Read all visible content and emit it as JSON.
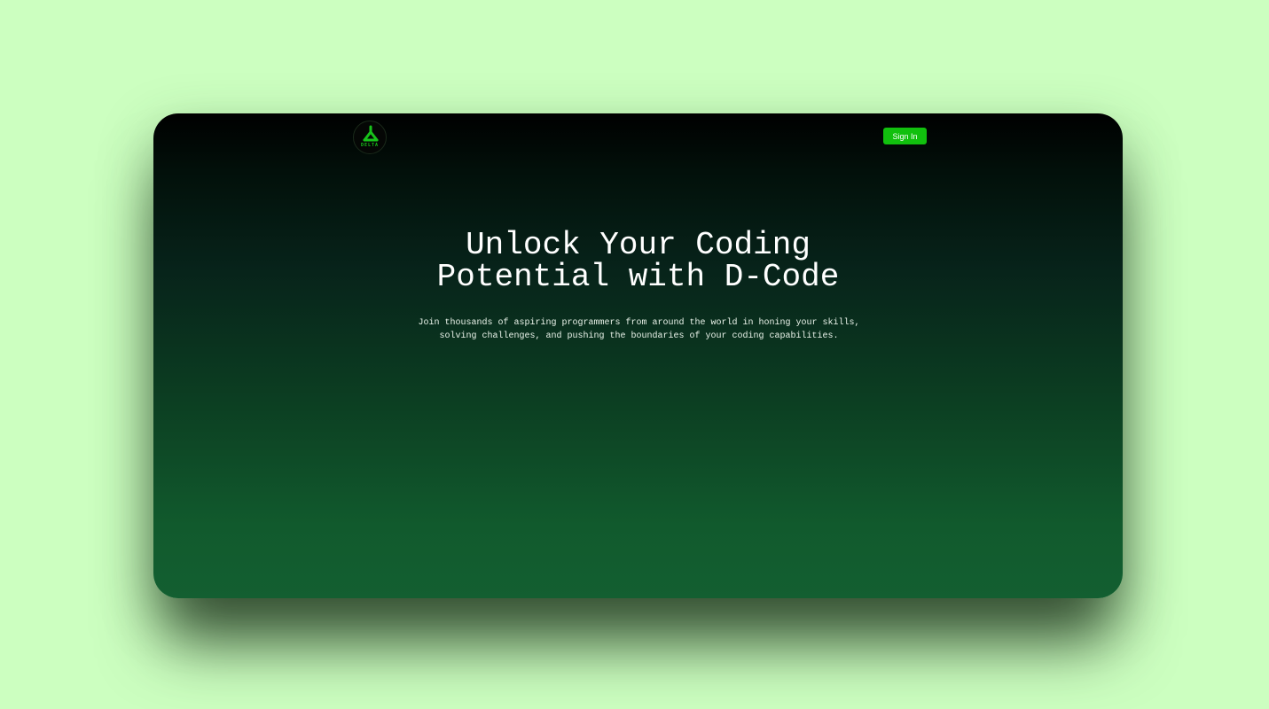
{
  "page": {
    "background_color": "#ccffc0",
    "card_gradient": [
      "#000000",
      "#135f31"
    ]
  },
  "header": {
    "logo": {
      "icon": "delta-triangle-logo-icon",
      "text": "DELTA",
      "color": "#18c21b"
    },
    "signin_label": "Sign In",
    "signin_color": "#11c00e"
  },
  "hero": {
    "title_line1": "Unlock Your Coding",
    "title_line2": "Potential with D-Code",
    "subtitle": "Join thousands of aspiring programmers from around the world in honing your skills, solving challenges, and pushing the boundaries of your coding capabilities."
  }
}
